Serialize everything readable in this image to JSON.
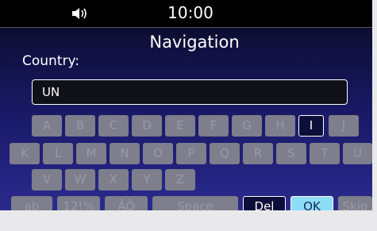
{
  "status": {
    "time": "10:00",
    "volume_icon": "speaker-volume-icon"
  },
  "header": {
    "title": "Navigation"
  },
  "form": {
    "label": "Country:",
    "value": "UN"
  },
  "keyboard": {
    "row1": [
      "A",
      "B",
      "C",
      "D",
      "E",
      "F",
      "G",
      "H",
      "I",
      "J"
    ],
    "row2": [
      "K",
      "L",
      "M",
      "N",
      "O",
      "P",
      "Q",
      "R",
      "S",
      "T",
      "U"
    ],
    "row3": [
      "V",
      "W",
      "X",
      "Y",
      "Z"
    ],
    "bottom": [
      "ab",
      "12!%",
      "ÄÖ",
      "Space",
      "Del",
      "OK",
      "Skip"
    ]
  },
  "colors": {
    "accent": "#8fdcf6",
    "key_disabled": "#7e7e8c",
    "background_top": "#0a0a14",
    "background_bottom": "#2a2a8e"
  }
}
